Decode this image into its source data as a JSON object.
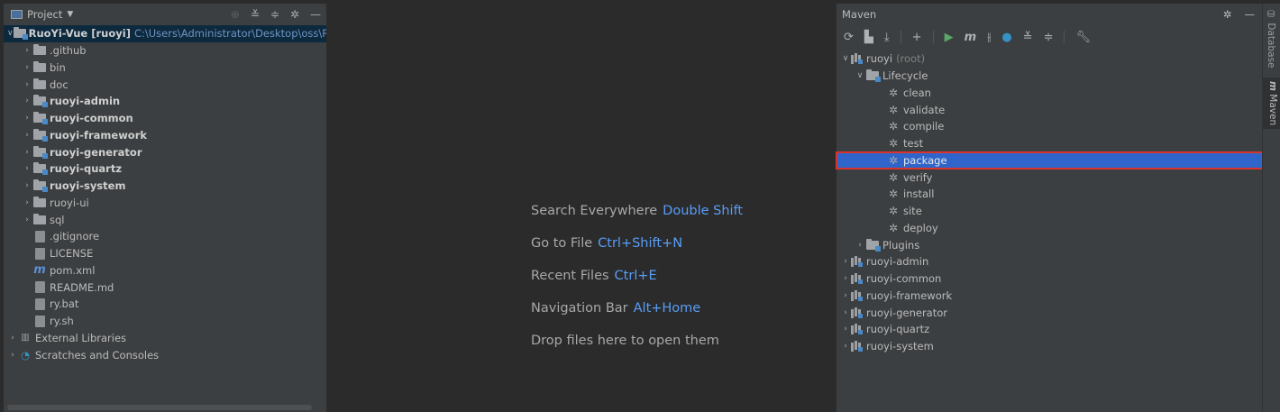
{
  "project": {
    "title": "Project",
    "root": {
      "name": "RuoYi-Vue",
      "module": "[ruoyi]",
      "path": "C:\\Users\\Administrator\\Desktop\\oss\\RuoYi-V"
    },
    "items": [
      {
        "label": ".github",
        "type": "folder",
        "bold": false,
        "arrow": true
      },
      {
        "label": "bin",
        "type": "folder",
        "bold": false,
        "arrow": true
      },
      {
        "label": "doc",
        "type": "folder",
        "bold": false,
        "arrow": true
      },
      {
        "label": "ruoyi-admin",
        "type": "module",
        "bold": true,
        "arrow": true
      },
      {
        "label": "ruoyi-common",
        "type": "module",
        "bold": true,
        "arrow": true
      },
      {
        "label": "ruoyi-framework",
        "type": "module",
        "bold": true,
        "arrow": true
      },
      {
        "label": "ruoyi-generator",
        "type": "module",
        "bold": true,
        "arrow": true
      },
      {
        "label": "ruoyi-quartz",
        "type": "module",
        "bold": true,
        "arrow": true
      },
      {
        "label": "ruoyi-system",
        "type": "module",
        "bold": true,
        "arrow": true
      },
      {
        "label": "ruoyi-ui",
        "type": "folder",
        "bold": false,
        "arrow": true
      },
      {
        "label": "sql",
        "type": "folder",
        "bold": false,
        "arrow": true
      },
      {
        "label": ".gitignore",
        "type": "file",
        "bold": false,
        "arrow": false
      },
      {
        "label": "LICENSE",
        "type": "file",
        "bold": false,
        "arrow": false
      },
      {
        "label": "pom.xml",
        "type": "maven",
        "bold": false,
        "arrow": false
      },
      {
        "label": "README.md",
        "type": "file",
        "bold": false,
        "arrow": false
      },
      {
        "label": "ry.bat",
        "type": "file",
        "bold": false,
        "arrow": false
      },
      {
        "label": "ry.sh",
        "type": "file",
        "bold": false,
        "arrow": false
      }
    ],
    "external_libraries": "External Libraries",
    "scratches": "Scratches and Consoles"
  },
  "editor": {
    "hints": [
      {
        "text": "Search Everywhere",
        "key": "Double Shift"
      },
      {
        "text": "Go to File",
        "key": "Ctrl+Shift+N"
      },
      {
        "text": "Recent Files",
        "key": "Ctrl+E"
      },
      {
        "text": "Navigation Bar",
        "key": "Alt+Home"
      },
      {
        "text": "Drop files here to open them",
        "key": ""
      }
    ]
  },
  "maven": {
    "title": "Maven",
    "root_label": "ruoyi",
    "root_suffix": "(root)",
    "lifecycle_label": "Lifecycle",
    "lifecycle": [
      "clean",
      "validate",
      "compile",
      "test",
      "package",
      "verify",
      "install",
      "site",
      "deploy"
    ],
    "selected": "package",
    "plugins_label": "Plugins",
    "modules": [
      "ruoyi-admin",
      "ruoyi-common",
      "ruoyi-framework",
      "ruoyi-generator",
      "ruoyi-quartz",
      "ruoyi-system"
    ]
  },
  "right_strip": {
    "database": "Database",
    "maven": "Maven"
  },
  "colors": {
    "accent": "#589df6",
    "selection": "#2f65ca",
    "highlight_border": "#d9342b"
  }
}
